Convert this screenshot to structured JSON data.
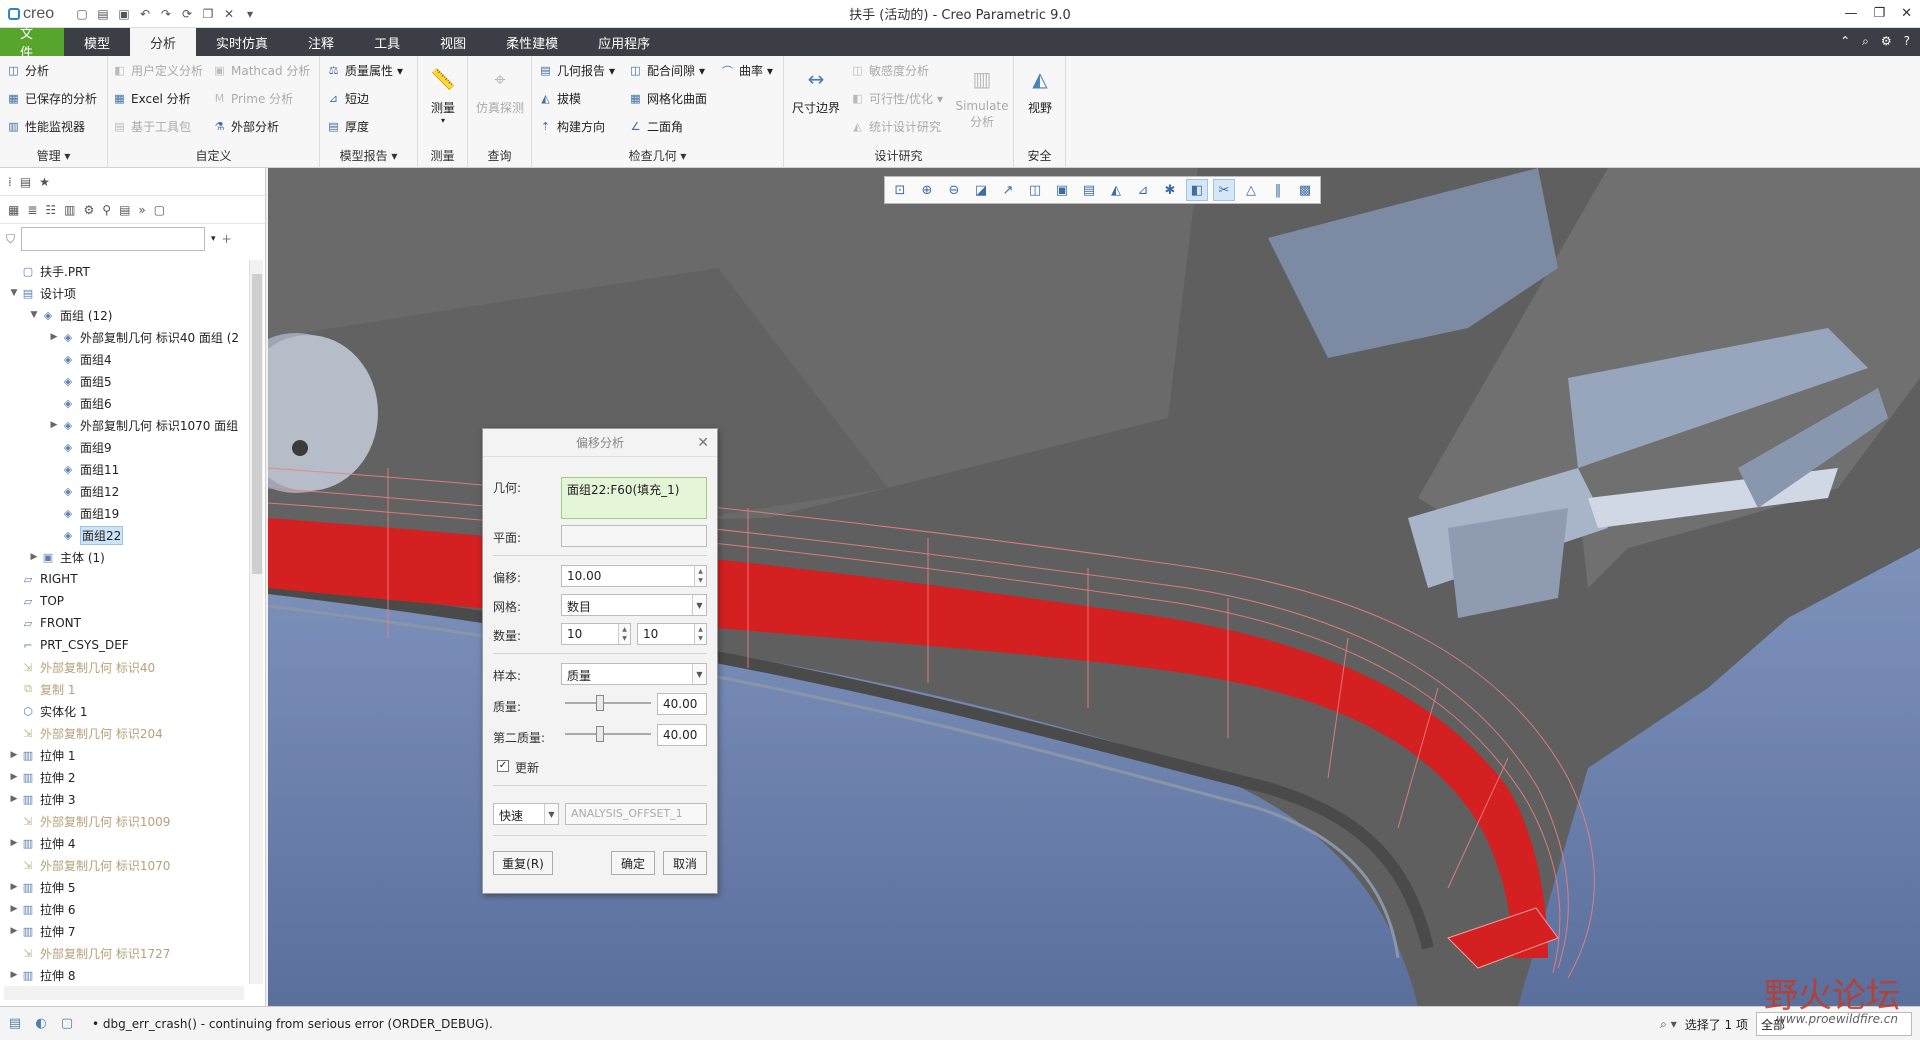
{
  "app": {
    "title": "扶手 (活动的) - Creo Parametric 9.0",
    "logo": "creo"
  },
  "menubar": {
    "tabs": [
      "文件",
      "模型",
      "分析",
      "实时仿真",
      "注释",
      "工具",
      "视图",
      "柔性建模",
      "应用程序"
    ]
  },
  "ribbon": {
    "manage": {
      "title": "管理",
      "items": [
        "分析",
        "已保存的分析",
        "性能监视器"
      ]
    },
    "custom": {
      "title": "自定义",
      "items": [
        "用户定义分析",
        "Excel 分析",
        "基于工具包",
        "Mathcad 分析",
        "Prime 分析",
        "外部分析"
      ]
    },
    "model_report": {
      "title": "模型报告",
      "items": [
        "质量属性",
        "短边",
        "厚度"
      ]
    },
    "measure": {
      "title": "测量",
      "label": "测量"
    },
    "query": {
      "title": "查询",
      "label": "仿真探测"
    },
    "inspect": {
      "title": "检查几何",
      "items": [
        "几何报告",
        "拔模",
        "构建方向",
        "配合间隙",
        "网格化曲面",
        "二面角",
        "曲率"
      ]
    },
    "design": {
      "title": "设计研究",
      "dim": "尺寸边界",
      "items": [
        "敏感度分析",
        "可行性/优化",
        "统计设计研究"
      ],
      "simulate": "Simulate 分析"
    },
    "safety": {
      "title": "安全",
      "label": "视野"
    }
  },
  "tree": {
    "filter_placeholder": "",
    "items": [
      {
        "label": "扶手.PRT",
        "indent": 0,
        "twisty": "",
        "icon": "part-icon",
        "style": ""
      },
      {
        "label": "设计项",
        "indent": 0,
        "twisty": "▼",
        "icon": "design-items-icon",
        "style": ""
      },
      {
        "label": "面组 (12)",
        "indent": 1,
        "twisty": "▼",
        "icon": "quilt-icon",
        "style": ""
      },
      {
        "label": "外部复制几何 标识40 面组 (2",
        "indent": 2,
        "twisty": "▶",
        "icon": "quilt-icon",
        "style": ""
      },
      {
        "label": "面组4",
        "indent": 2,
        "twisty": "",
        "icon": "quilt-icon",
        "style": ""
      },
      {
        "label": "面组5",
        "indent": 2,
        "twisty": "",
        "icon": "quilt-icon",
        "style": ""
      },
      {
        "label": "面组6",
        "indent": 2,
        "twisty": "",
        "icon": "quilt-icon",
        "style": ""
      },
      {
        "label": "外部复制几何 标识1070 面组",
        "indent": 2,
        "twisty": "▶",
        "icon": "quilt-icon",
        "style": ""
      },
      {
        "label": "面组9",
        "indent": 2,
        "twisty": "",
        "icon": "quilt-icon",
        "style": ""
      },
      {
        "label": "面组11",
        "indent": 2,
        "twisty": "",
        "icon": "quilt-icon",
        "style": ""
      },
      {
        "label": "面组12",
        "indent": 2,
        "twisty": "",
        "icon": "quilt-icon",
        "style": ""
      },
      {
        "label": "面组19",
        "indent": 2,
        "twisty": "",
        "icon": "quilt-icon",
        "style": ""
      },
      {
        "label": "面组22",
        "indent": 2,
        "twisty": "",
        "icon": "quilt-icon",
        "style": "selected"
      },
      {
        "label": "主体 (1)",
        "indent": 1,
        "twisty": "▶",
        "icon": "body-icon",
        "style": ""
      },
      {
        "label": "RIGHT",
        "indent": 0,
        "twisty": "",
        "icon": "datum-plane-icon",
        "style": ""
      },
      {
        "label": "TOP",
        "indent": 0,
        "twisty": "",
        "icon": "datum-plane-icon",
        "style": ""
      },
      {
        "label": "FRONT",
        "indent": 0,
        "twisty": "",
        "icon": "datum-plane-icon",
        "style": ""
      },
      {
        "label": "PRT_CSYS_DEF",
        "indent": 0,
        "twisty": "",
        "icon": "csys-icon",
        "style": ""
      },
      {
        "label": "外部复制几何 标识40",
        "indent": 0,
        "twisty": "",
        "icon": "copy-geom-icon",
        "style": "dim"
      },
      {
        "label": "复制 1",
        "indent": 0,
        "twisty": "",
        "icon": "copy-icon",
        "style": "dim"
      },
      {
        "label": "实体化 1",
        "indent": 0,
        "twisty": "",
        "icon": "solidify-icon",
        "style": ""
      },
      {
        "label": "外部复制几何 标识204",
        "indent": 0,
        "twisty": "",
        "icon": "copy-geom-icon",
        "style": "dim"
      },
      {
        "label": "拉伸 1",
        "indent": 0,
        "twisty": "▶",
        "icon": "extrude-icon",
        "style": ""
      },
      {
        "label": "拉伸 2",
        "indent": 0,
        "twisty": "▶",
        "icon": "extrude-icon",
        "style": ""
      },
      {
        "label": "拉伸 3",
        "indent": 0,
        "twisty": "▶",
        "icon": "extrude-icon",
        "style": ""
      },
      {
        "label": "外部复制几何 标识1009",
        "indent": 0,
        "twisty": "",
        "icon": "copy-geom-icon",
        "style": "dim"
      },
      {
        "label": "拉伸 4",
        "indent": 0,
        "twisty": "▶",
        "icon": "extrude-icon",
        "style": ""
      },
      {
        "label": "外部复制几何 标识1070",
        "indent": 0,
        "twisty": "",
        "icon": "copy-geom-icon",
        "style": "dim"
      },
      {
        "label": "拉伸 5",
        "indent": 0,
        "twisty": "▶",
        "icon": "extrude-icon",
        "style": ""
      },
      {
        "label": "拉伸 6",
        "indent": 0,
        "twisty": "▶",
        "icon": "extrude-icon",
        "style": ""
      },
      {
        "label": "拉伸 7",
        "indent": 0,
        "twisty": "▶",
        "icon": "extrude-icon",
        "style": ""
      },
      {
        "label": "外部复制几何 标识1727",
        "indent": 0,
        "twisty": "",
        "icon": "copy-geom-icon",
        "style": "dim"
      },
      {
        "label": "拉伸 8",
        "indent": 0,
        "twisty": "▶",
        "icon": "extrude-icon",
        "style": ""
      }
    ]
  },
  "dialog": {
    "title": "偏移分析",
    "geometry_label": "几何:",
    "geometry_value": "面组22:F60(填充_1)",
    "plane_label": "平面:",
    "plane_value": "",
    "offset_label": "偏移:",
    "offset_value": "10.00",
    "mesh_label": "网格:",
    "mesh_value": "数目",
    "count_label": "数量:",
    "count_u": "10",
    "count_v": "10",
    "sample_label": "样本:",
    "sample_value": "质量",
    "quality_label": "质量:",
    "quality_value": "40.00",
    "quality_level": 0.4,
    "second_quality_label": "第二质量:",
    "second_quality_value": "40.00",
    "second_quality_level": 0.4,
    "update_label": "更新",
    "update_checked": true,
    "mode_value": "快速",
    "analysis_name": "ANALYSIS_OFFSET_1",
    "repeat_button": "重复(R)",
    "ok_button": "确定",
    "cancel_button": "取消"
  },
  "status": {
    "message": "dbg_err_crash() - continuing from serious error (ORDER_DEBUG).",
    "selection": "选择了 1 项",
    "filter": "全部"
  },
  "watermark": {
    "text": "野火论坛",
    "url": "www.proewildfire.cn"
  },
  "colors": {
    "accent": "#58a52e",
    "menubar": "#3b3f45",
    "highlight_red": "#d42020"
  }
}
